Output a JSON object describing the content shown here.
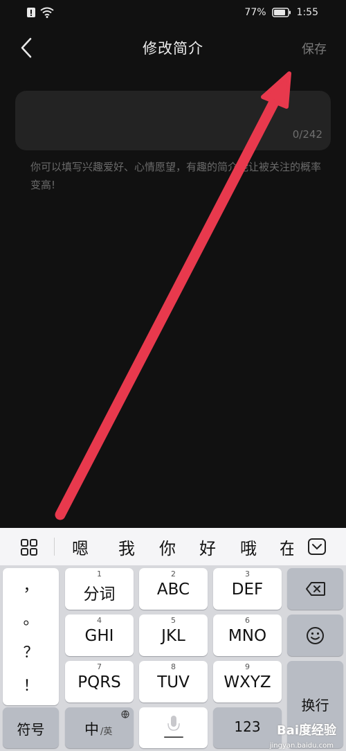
{
  "status": {
    "battery": "77%",
    "time": "1:55"
  },
  "header": {
    "title": "修改简介",
    "save_label": "保存"
  },
  "bio": {
    "value": "",
    "counter": "0/242",
    "hint": "你可以填写兴趣爱好、心情愿望，有趣的简介能让被关注的概率变高!"
  },
  "keyboard": {
    "candidates": [
      "嗯",
      "我",
      "你",
      "好",
      "哦",
      "在"
    ],
    "punctuation": [
      "，",
      "。",
      "？",
      "！"
    ],
    "keys": [
      {
        "num": "1",
        "label": "分词"
      },
      {
        "num": "2",
        "label": "ABC"
      },
      {
        "num": "3",
        "label": "DEF"
      },
      {
        "num": "4",
        "label": "GHI"
      },
      {
        "num": "5",
        "label": "JKL"
      },
      {
        "num": "6",
        "label": "MNO"
      },
      {
        "num": "7",
        "label": "PQRS"
      },
      {
        "num": "8",
        "label": "TUV"
      },
      {
        "num": "9",
        "label": "WXYZ"
      }
    ],
    "symbols_label": "符号",
    "lang_label": "中",
    "lang_alt": "/英",
    "numbers_label": "123",
    "enter_label": "换行",
    "watermark": "Bai度经验",
    "watermark_url": "jingyan.baidu.com"
  },
  "colors": {
    "annotation_arrow": "#e8394d",
    "background": "#111111"
  }
}
